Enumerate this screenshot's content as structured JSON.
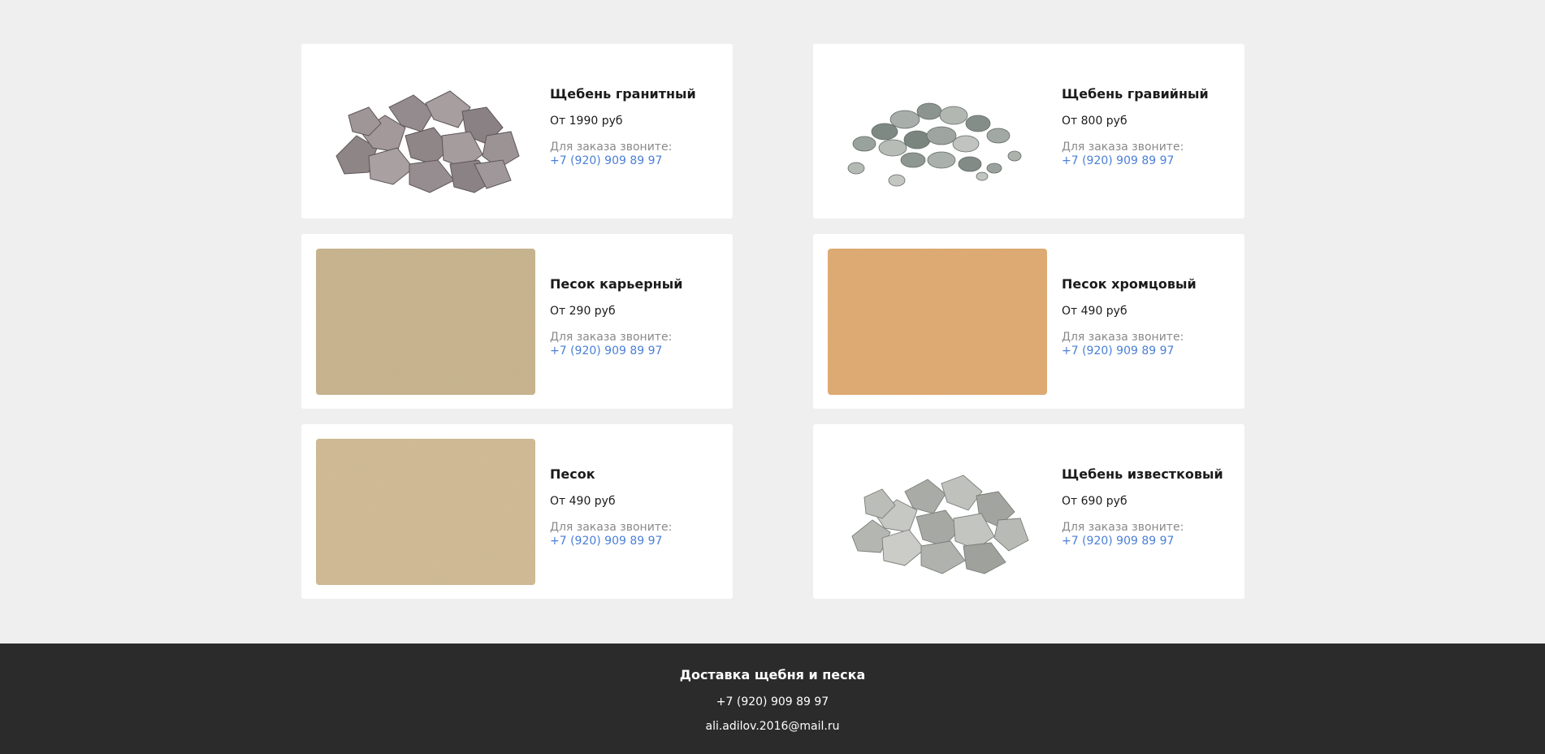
{
  "products": [
    {
      "title": "Щебень гранитный",
      "price": "От 1990 руб",
      "order_label": "Для заказа звоните:",
      "phone": "+7 (920) 909 89 97",
      "image": "granite-gravel-pile"
    },
    {
      "title": "Щебень гравийный",
      "price": "От 800 руб",
      "order_label": "Для заказа звоните:",
      "phone": "+7 (920) 909 89 97",
      "image": "gravel-pile"
    },
    {
      "title": "Песок карьерный",
      "price": "От 290 руб",
      "order_label": "Для заказа звоните:",
      "phone": "+7 (920) 909 89 97",
      "image": "quarry-sand-texture"
    },
    {
      "title": "Песок хромцовый",
      "price": "От 490 руб",
      "order_label": "Для заказа звоните:",
      "phone": "+7 (920) 909 89 97",
      "image": "orange-sand-texture"
    },
    {
      "title": "Песок",
      "price": "От 490 руб",
      "order_label": "Для заказа звоните:",
      "phone": "+7 (920) 909 89 97",
      "image": "sand-texture"
    },
    {
      "title": "Щебень известковый",
      "price": "От 690 руб",
      "order_label": "Для заказа звоните:",
      "phone": "+7 (920) 909 89 97",
      "image": "limestone-gravel-pile"
    }
  ],
  "footer": {
    "title": "Доставка щебня и песка",
    "phone": "+7 (920) 909 89 97",
    "email": "ali.adilov.2016@mail.ru"
  },
  "colors": {
    "page_background": "#efefef",
    "card_background": "#ffffff",
    "link": "#4a7fd6",
    "muted_text": "#8a8a8a",
    "footer_background": "#2b2b2b"
  }
}
